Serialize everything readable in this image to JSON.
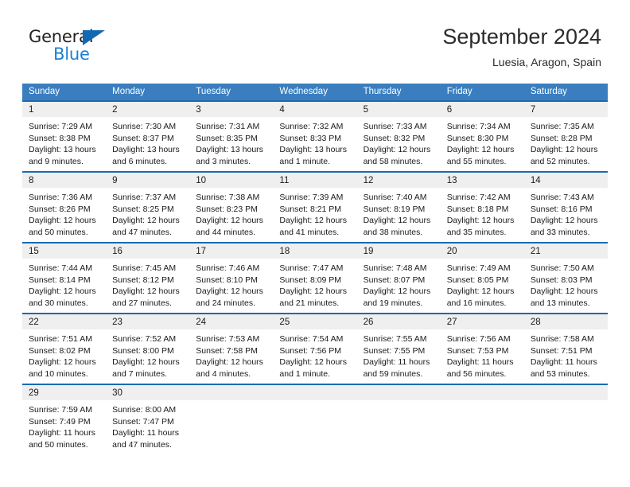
{
  "brand": {
    "name_top": "General",
    "name_bottom": "Blue",
    "triangle_color": "#1268b3",
    "text_color_top": "#231f20",
    "text_color_bottom": "#1c7fd4"
  },
  "header": {
    "title": "September 2024",
    "subtitle": "Luesia, Aragon, Spain"
  },
  "calendar": {
    "header_bg": "#3a7ebf",
    "row_border_color": "#1a6bb0",
    "day_strip_bg": "#efefef",
    "weekdays": [
      "Sunday",
      "Monday",
      "Tuesday",
      "Wednesday",
      "Thursday",
      "Friday",
      "Saturday"
    ],
    "weeks": [
      [
        {
          "day": "1",
          "sunrise": "Sunrise: 7:29 AM",
          "sunset": "Sunset: 8:38 PM",
          "daylight_line1": "Daylight: 13 hours",
          "daylight_line2": "and 9 minutes."
        },
        {
          "day": "2",
          "sunrise": "Sunrise: 7:30 AM",
          "sunset": "Sunset: 8:37 PM",
          "daylight_line1": "Daylight: 13 hours",
          "daylight_line2": "and 6 minutes."
        },
        {
          "day": "3",
          "sunrise": "Sunrise: 7:31 AM",
          "sunset": "Sunset: 8:35 PM",
          "daylight_line1": "Daylight: 13 hours",
          "daylight_line2": "and 3 minutes."
        },
        {
          "day": "4",
          "sunrise": "Sunrise: 7:32 AM",
          "sunset": "Sunset: 8:33 PM",
          "daylight_line1": "Daylight: 13 hours",
          "daylight_line2": "and 1 minute."
        },
        {
          "day": "5",
          "sunrise": "Sunrise: 7:33 AM",
          "sunset": "Sunset: 8:32 PM",
          "daylight_line1": "Daylight: 12 hours",
          "daylight_line2": "and 58 minutes."
        },
        {
          "day": "6",
          "sunrise": "Sunrise: 7:34 AM",
          "sunset": "Sunset: 8:30 PM",
          "daylight_line1": "Daylight: 12 hours",
          "daylight_line2": "and 55 minutes."
        },
        {
          "day": "7",
          "sunrise": "Sunrise: 7:35 AM",
          "sunset": "Sunset: 8:28 PM",
          "daylight_line1": "Daylight: 12 hours",
          "daylight_line2": "and 52 minutes."
        }
      ],
      [
        {
          "day": "8",
          "sunrise": "Sunrise: 7:36 AM",
          "sunset": "Sunset: 8:26 PM",
          "daylight_line1": "Daylight: 12 hours",
          "daylight_line2": "and 50 minutes."
        },
        {
          "day": "9",
          "sunrise": "Sunrise: 7:37 AM",
          "sunset": "Sunset: 8:25 PM",
          "daylight_line1": "Daylight: 12 hours",
          "daylight_line2": "and 47 minutes."
        },
        {
          "day": "10",
          "sunrise": "Sunrise: 7:38 AM",
          "sunset": "Sunset: 8:23 PM",
          "daylight_line1": "Daylight: 12 hours",
          "daylight_line2": "and 44 minutes."
        },
        {
          "day": "11",
          "sunrise": "Sunrise: 7:39 AM",
          "sunset": "Sunset: 8:21 PM",
          "daylight_line1": "Daylight: 12 hours",
          "daylight_line2": "and 41 minutes."
        },
        {
          "day": "12",
          "sunrise": "Sunrise: 7:40 AM",
          "sunset": "Sunset: 8:19 PM",
          "daylight_line1": "Daylight: 12 hours",
          "daylight_line2": "and 38 minutes."
        },
        {
          "day": "13",
          "sunrise": "Sunrise: 7:42 AM",
          "sunset": "Sunset: 8:18 PM",
          "daylight_line1": "Daylight: 12 hours",
          "daylight_line2": "and 35 minutes."
        },
        {
          "day": "14",
          "sunrise": "Sunrise: 7:43 AM",
          "sunset": "Sunset: 8:16 PM",
          "daylight_line1": "Daylight: 12 hours",
          "daylight_line2": "and 33 minutes."
        }
      ],
      [
        {
          "day": "15",
          "sunrise": "Sunrise: 7:44 AM",
          "sunset": "Sunset: 8:14 PM",
          "daylight_line1": "Daylight: 12 hours",
          "daylight_line2": "and 30 minutes."
        },
        {
          "day": "16",
          "sunrise": "Sunrise: 7:45 AM",
          "sunset": "Sunset: 8:12 PM",
          "daylight_line1": "Daylight: 12 hours",
          "daylight_line2": "and 27 minutes."
        },
        {
          "day": "17",
          "sunrise": "Sunrise: 7:46 AM",
          "sunset": "Sunset: 8:10 PM",
          "daylight_line1": "Daylight: 12 hours",
          "daylight_line2": "and 24 minutes."
        },
        {
          "day": "18",
          "sunrise": "Sunrise: 7:47 AM",
          "sunset": "Sunset: 8:09 PM",
          "daylight_line1": "Daylight: 12 hours",
          "daylight_line2": "and 21 minutes."
        },
        {
          "day": "19",
          "sunrise": "Sunrise: 7:48 AM",
          "sunset": "Sunset: 8:07 PM",
          "daylight_line1": "Daylight: 12 hours",
          "daylight_line2": "and 19 minutes."
        },
        {
          "day": "20",
          "sunrise": "Sunrise: 7:49 AM",
          "sunset": "Sunset: 8:05 PM",
          "daylight_line1": "Daylight: 12 hours",
          "daylight_line2": "and 16 minutes."
        },
        {
          "day": "21",
          "sunrise": "Sunrise: 7:50 AM",
          "sunset": "Sunset: 8:03 PM",
          "daylight_line1": "Daylight: 12 hours",
          "daylight_line2": "and 13 minutes."
        }
      ],
      [
        {
          "day": "22",
          "sunrise": "Sunrise: 7:51 AM",
          "sunset": "Sunset: 8:02 PM",
          "daylight_line1": "Daylight: 12 hours",
          "daylight_line2": "and 10 minutes."
        },
        {
          "day": "23",
          "sunrise": "Sunrise: 7:52 AM",
          "sunset": "Sunset: 8:00 PM",
          "daylight_line1": "Daylight: 12 hours",
          "daylight_line2": "and 7 minutes."
        },
        {
          "day": "24",
          "sunrise": "Sunrise: 7:53 AM",
          "sunset": "Sunset: 7:58 PM",
          "daylight_line1": "Daylight: 12 hours",
          "daylight_line2": "and 4 minutes."
        },
        {
          "day": "25",
          "sunrise": "Sunrise: 7:54 AM",
          "sunset": "Sunset: 7:56 PM",
          "daylight_line1": "Daylight: 12 hours",
          "daylight_line2": "and 1 minute."
        },
        {
          "day": "26",
          "sunrise": "Sunrise: 7:55 AM",
          "sunset": "Sunset: 7:55 PM",
          "daylight_line1": "Daylight: 11 hours",
          "daylight_line2": "and 59 minutes."
        },
        {
          "day": "27",
          "sunrise": "Sunrise: 7:56 AM",
          "sunset": "Sunset: 7:53 PM",
          "daylight_line1": "Daylight: 11 hours",
          "daylight_line2": "and 56 minutes."
        },
        {
          "day": "28",
          "sunrise": "Sunrise: 7:58 AM",
          "sunset": "Sunset: 7:51 PM",
          "daylight_line1": "Daylight: 11 hours",
          "daylight_line2": "and 53 minutes."
        }
      ],
      [
        {
          "day": "29",
          "sunrise": "Sunrise: 7:59 AM",
          "sunset": "Sunset: 7:49 PM",
          "daylight_line1": "Daylight: 11 hours",
          "daylight_line2": "and 50 minutes."
        },
        {
          "day": "30",
          "sunrise": "Sunrise: 8:00 AM",
          "sunset": "Sunset: 7:47 PM",
          "daylight_line1": "Daylight: 11 hours",
          "daylight_line2": "and 47 minutes."
        },
        {
          "day": "",
          "sunrise": "",
          "sunset": "",
          "daylight_line1": "",
          "daylight_line2": ""
        },
        {
          "day": "",
          "sunrise": "",
          "sunset": "",
          "daylight_line1": "",
          "daylight_line2": ""
        },
        {
          "day": "",
          "sunrise": "",
          "sunset": "",
          "daylight_line1": "",
          "daylight_line2": ""
        },
        {
          "day": "",
          "sunrise": "",
          "sunset": "",
          "daylight_line1": "",
          "daylight_line2": ""
        },
        {
          "day": "",
          "sunrise": "",
          "sunset": "",
          "daylight_line1": "",
          "daylight_line2": ""
        }
      ]
    ]
  }
}
